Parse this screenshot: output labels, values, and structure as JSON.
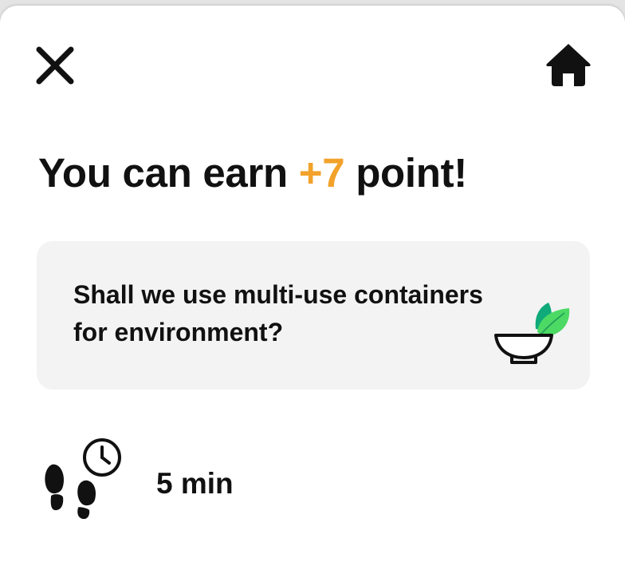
{
  "header": {
    "close_icon": "close-icon",
    "home_icon": "home-icon"
  },
  "headline": {
    "prefix": "You can earn ",
    "points": "+7",
    "suffix": " point!",
    "points_color": "#f2a22b"
  },
  "mission": {
    "line1": "Shall we use multi-use containers",
    "line2": "for environment?",
    "icon": "bowl-leaf-icon",
    "leaf_colors": [
      "#0fa97a",
      "#4cd964"
    ]
  },
  "duration": {
    "icon": "footsteps-clock-icon",
    "label": "5 min"
  }
}
